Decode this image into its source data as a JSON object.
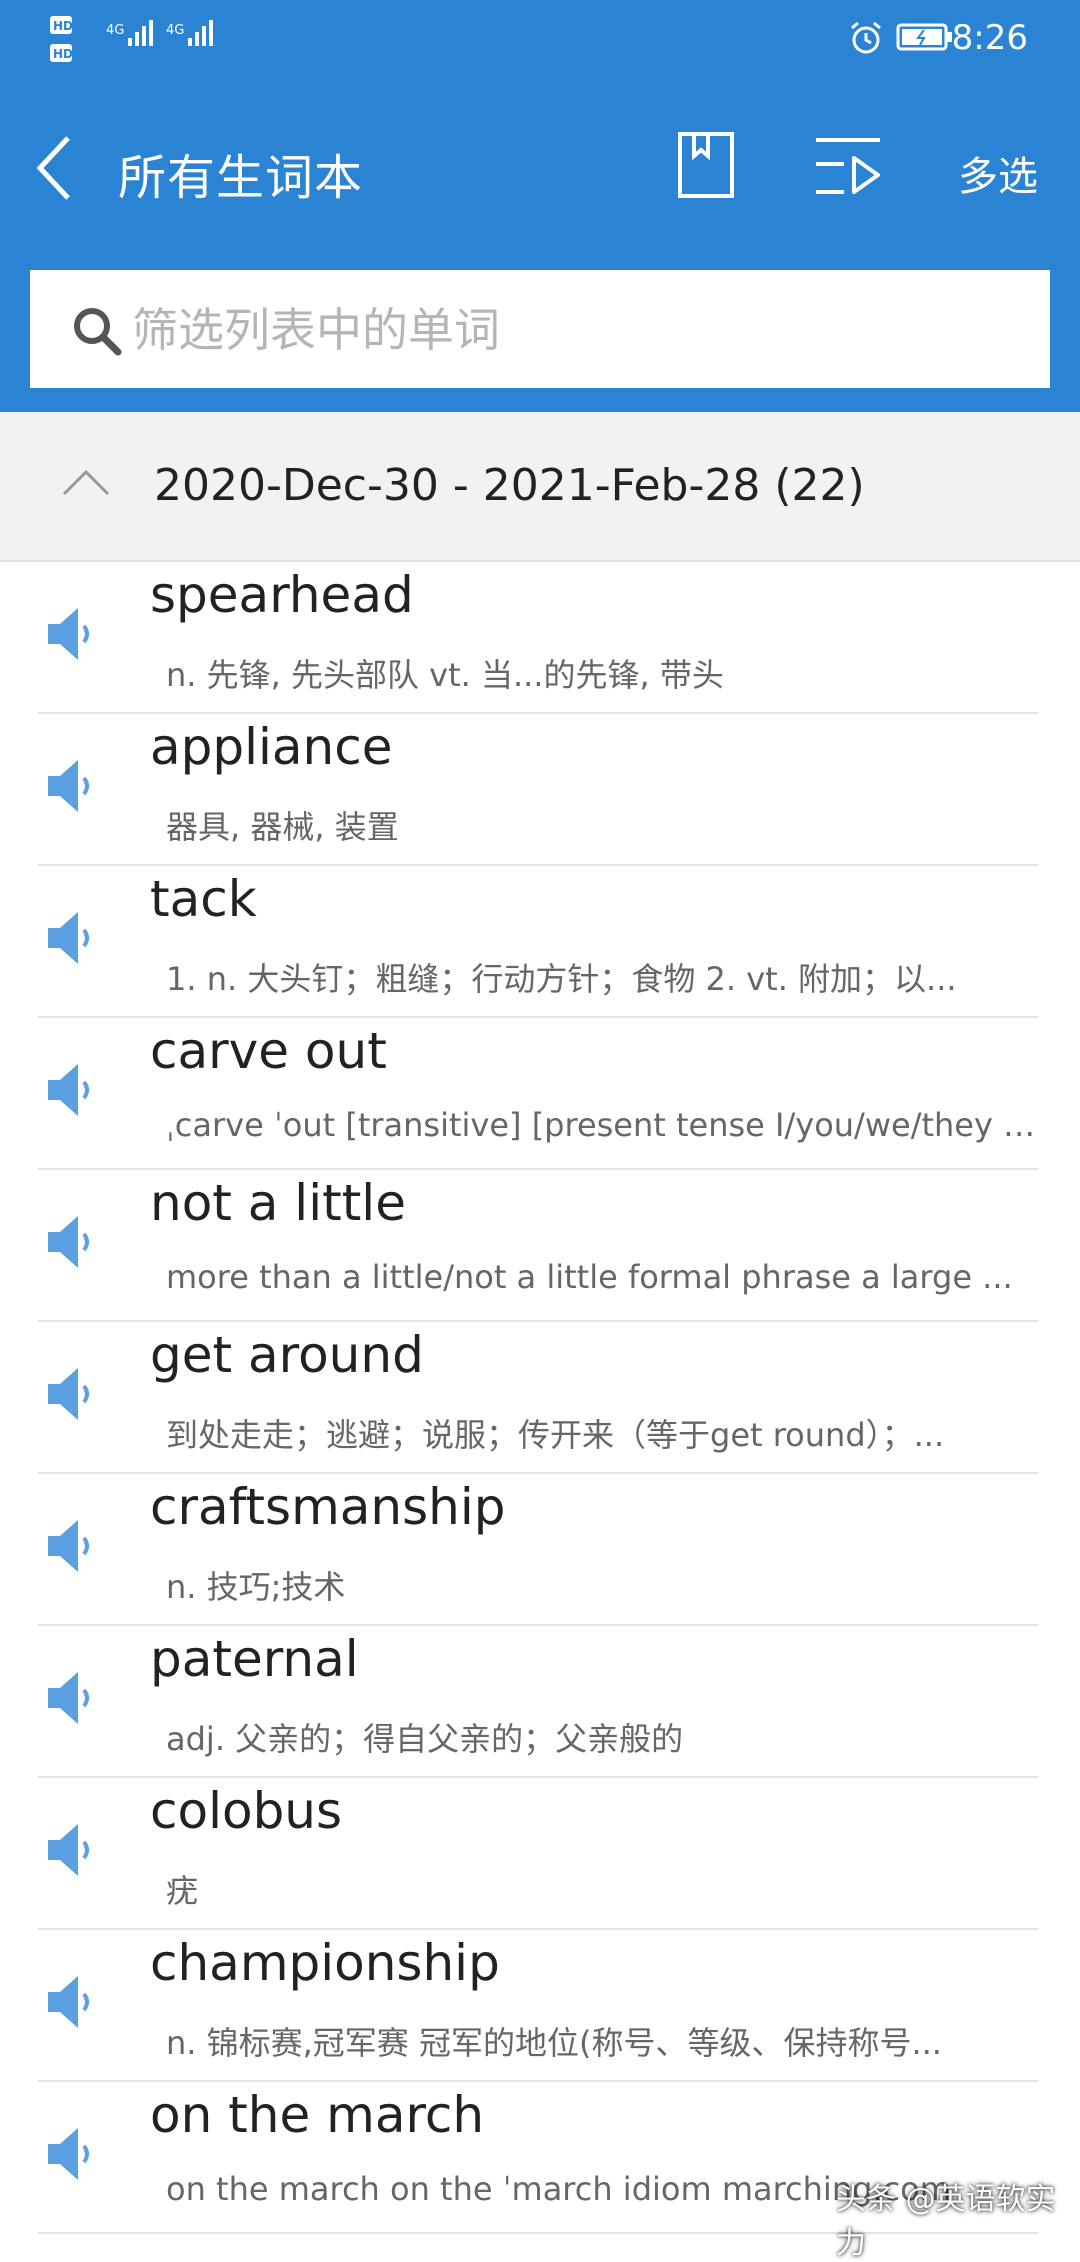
{
  "status": {
    "time": "8:26"
  },
  "header": {
    "title": "所有生词本",
    "multi_select": "多选"
  },
  "search": {
    "placeholder": "筛选列表中的单词",
    "value": ""
  },
  "group": {
    "label": "2020-Dec-30 - 2021-Feb-28 (22)"
  },
  "entries": [
    {
      "word": "spearhead",
      "definition": "n. 先锋, 先头部队 vt. 当...的先锋, 带头"
    },
    {
      "word": "appliance",
      "definition": "器具, 器械, 装置"
    },
    {
      "word": "tack",
      "definition": "1. n. 大头钉；粗缝；行动方针；食物 2. vt. 附加；以..."
    },
    {
      "word": "carve out",
      "definition": "ˌcarve ˈout [transitive] [present tense I/you/we/they ca..."
    },
    {
      "word": "not a little",
      "definition": "more than a little/not a little formal phrase    a large ..."
    },
    {
      "word": "get around",
      "definition": "到处走走；逃避；说服；传开来（等于get round）；..."
    },
    {
      "word": "craftsmanship",
      "definition": "n. 技巧;技术"
    },
    {
      "word": "paternal",
      "definition": "adj. 父亲的；得自父亲的；父亲般的"
    },
    {
      "word": "colobus",
      "definition": "疣"
    },
    {
      "word": "championship",
      "definition": "n. 锦标赛,冠军赛 冠军的地位(称号、等级、保持称号..."
    },
    {
      "word": "on the march",
      "definition": "on the march    on the ˈmarch   idiom    marching.com"
    }
  ],
  "watermark": "头条 @英语软实力",
  "colors": {
    "header": "#2b84d3",
    "speaker": "#5a9fe0",
    "group_bg": "#f2f2f2"
  }
}
